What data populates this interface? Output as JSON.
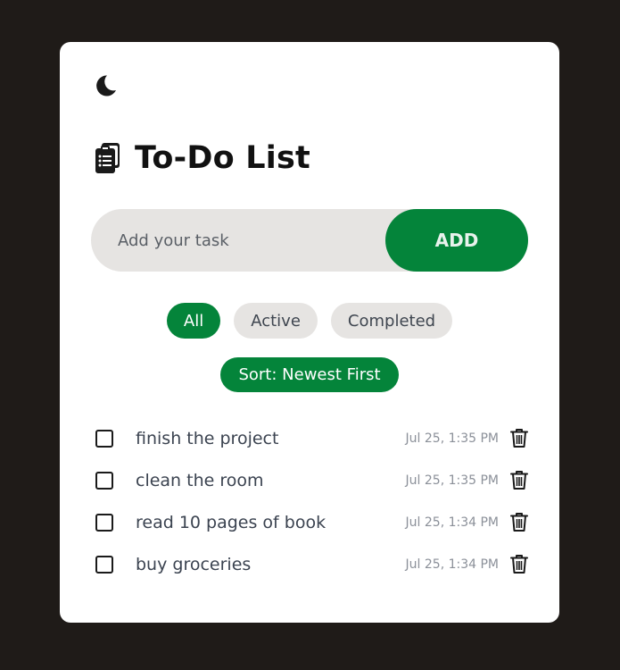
{
  "app": {
    "title": "To-Do List",
    "theme_toggle_icon": "moon-icon",
    "title_icon": "clipboard-icon"
  },
  "input": {
    "placeholder": "Add your task",
    "value": "",
    "add_label": "ADD"
  },
  "filters": [
    {
      "label": "All",
      "active": true
    },
    {
      "label": "Active",
      "active": false
    },
    {
      "label": "Completed",
      "active": false
    }
  ],
  "sort": {
    "label": "Sort: Newest First"
  },
  "tasks": [
    {
      "text": "finish the project",
      "date": "Jul 25, 1:35 PM",
      "done": false
    },
    {
      "text": "clean the room",
      "date": "Jul 25, 1:35 PM",
      "done": false
    },
    {
      "text": "read 10 pages of book",
      "date": "Jul 25, 1:34 PM",
      "done": false
    },
    {
      "text": "buy groceries",
      "date": "Jul 25, 1:34 PM",
      "done": false
    }
  ],
  "colors": {
    "accent": "#04843a",
    "background": "#1f1b18",
    "card": "#ffffff",
    "pill": "#e6e4e2"
  }
}
